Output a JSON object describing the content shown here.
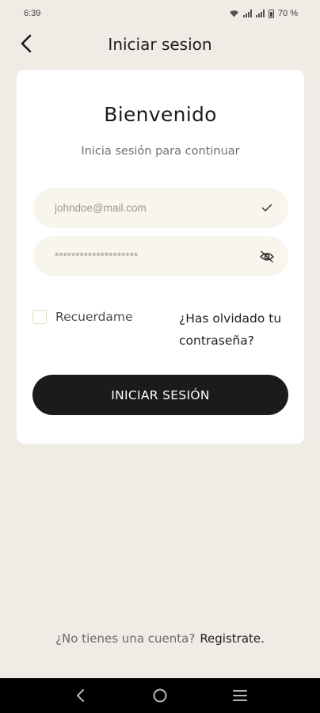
{
  "status_bar": {
    "time": "6:39",
    "battery": "70 %",
    "icons": [
      "wifi-icon",
      "signal-icon",
      "signal-icon",
      "battery-icon"
    ]
  },
  "header": {
    "title": "Iniciar sesion",
    "back_icon": "back-arrow-icon"
  },
  "card": {
    "welcome": "Bienvenido",
    "subtitle": "Inicia sesión para continuar",
    "email": {
      "placeholder": "johndoe@mail.com",
      "icon": "check-icon"
    },
    "password": {
      "placeholder": "********************",
      "icon": "eye-off-icon"
    },
    "remember_label": "Recuerdame",
    "remember_checked": false,
    "forgot_line1": "¿Has olvidado tu",
    "forgot_line2": "contraseña?",
    "login_button": "INICIAR SESIÓN"
  },
  "footer": {
    "question": "¿No tienes una cuenta?",
    "link": "Registrate."
  },
  "nav_bar": {
    "icons": [
      "nav-back-icon",
      "nav-home-icon",
      "nav-recents-icon"
    ]
  },
  "colors": {
    "background": "#efece6",
    "card": "#ffffff",
    "field": "#f8f5ec",
    "button": "#1b1a1c"
  }
}
